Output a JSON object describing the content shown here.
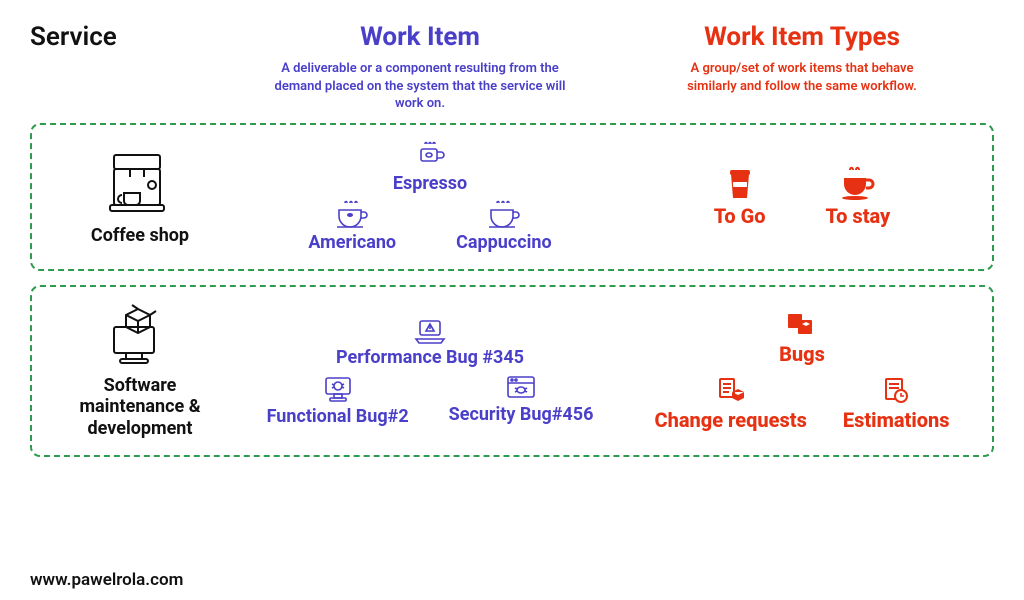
{
  "headers": {
    "service": "Service",
    "workitem": "Work Item",
    "types": "Work Item Types",
    "workitem_sub": "A deliverable or a component resulting from the demand placed on the system that the service will work on.",
    "types_sub": "A group/set of work items that behave similarly and follow the same workflow."
  },
  "rows": [
    {
      "service_label": "Coffee shop",
      "workitems_top": [
        {
          "label": "Espresso"
        }
      ],
      "workitems_bottom": [
        {
          "label": "Americano"
        },
        {
          "label": "Cappuccino"
        }
      ],
      "types_top": [],
      "types_bottom": [
        {
          "label": "To Go"
        },
        {
          "label": "To stay"
        }
      ]
    },
    {
      "service_label": "Software maintenance & development",
      "workitems_top": [
        {
          "label": "Performance Bug #345"
        }
      ],
      "workitems_bottom": [
        {
          "label": "Functional Bug#2"
        },
        {
          "label": "Security Bug#456"
        }
      ],
      "types_top": [
        {
          "label": "Bugs"
        }
      ],
      "types_bottom": [
        {
          "label": "Change requests"
        },
        {
          "label": "Estimations"
        }
      ]
    }
  ],
  "footer": "www.pawelrola.com"
}
